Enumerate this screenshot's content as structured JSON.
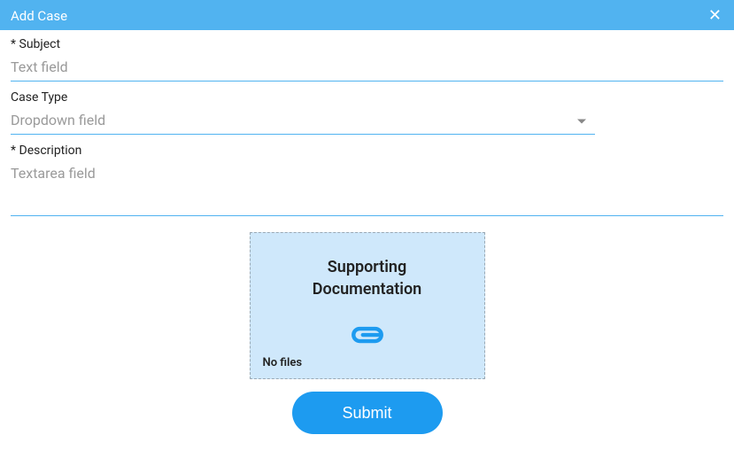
{
  "header": {
    "title": "Add Case",
    "close_glyph": "✕"
  },
  "form": {
    "subject": {
      "label": "* Subject",
      "placeholder": "Text field",
      "value": ""
    },
    "case_type": {
      "label": "Case Type",
      "placeholder": "Dropdown field"
    },
    "description": {
      "label": "* Description",
      "placeholder": "Textarea field",
      "value": ""
    }
  },
  "upload": {
    "title_line1": "Supporting",
    "title_line2": "Documentation",
    "nofiles": "No files"
  },
  "actions": {
    "submit": "Submit"
  }
}
